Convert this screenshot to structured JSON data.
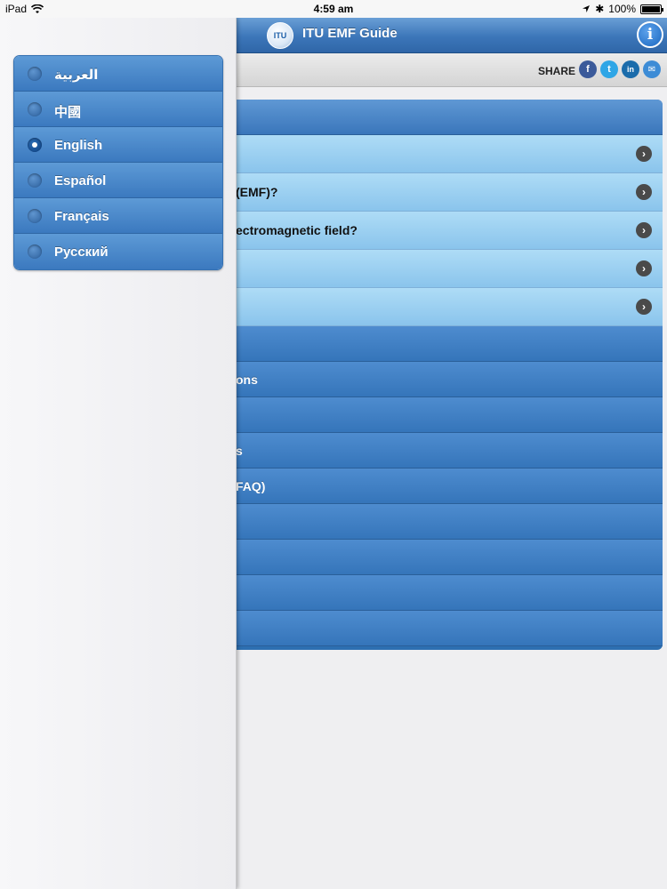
{
  "status_bar": {
    "device": "iPad",
    "time": "4:59 am",
    "battery": "100%"
  },
  "navbar": {
    "title": "ITU EMF Guide",
    "logo_text": "ITU",
    "info_label": "i"
  },
  "share": {
    "label": "SHARE",
    "icons": [
      {
        "name": "facebook-icon",
        "glyph": "f"
      },
      {
        "name": "twitter-icon",
        "glyph": "t"
      },
      {
        "name": "linkedin-icon",
        "glyph": "in"
      },
      {
        "name": "email-icon",
        "glyph": "✉"
      }
    ]
  },
  "menu": {
    "expanded_items": [
      {
        "label": ""
      },
      {
        "label": "(EMF)?"
      },
      {
        "label": "ectromagnetic field?"
      },
      {
        "label": ""
      },
      {
        "label": ""
      }
    ],
    "items": [
      {
        "label": ""
      },
      {
        "label": "ons"
      },
      {
        "label": ""
      },
      {
        "label": "s"
      },
      {
        "label": "FAQ)"
      },
      {
        "label": ""
      },
      {
        "label": ""
      },
      {
        "label": ""
      },
      {
        "label": ""
      }
    ]
  },
  "languages": {
    "selected": "English",
    "items": [
      {
        "label": "العربية",
        "selected": false
      },
      {
        "label": "中國",
        "selected": false
      },
      {
        "label": "English",
        "selected": true
      },
      {
        "label": "Español",
        "selected": false
      },
      {
        "label": "Français",
        "selected": false
      },
      {
        "label": "Русский",
        "selected": false
      }
    ]
  },
  "colors": {
    "nav_blue": "#3c76b9",
    "row_light_blue": "#9fd2f2",
    "drawer_bg": "#f3f3f5"
  }
}
